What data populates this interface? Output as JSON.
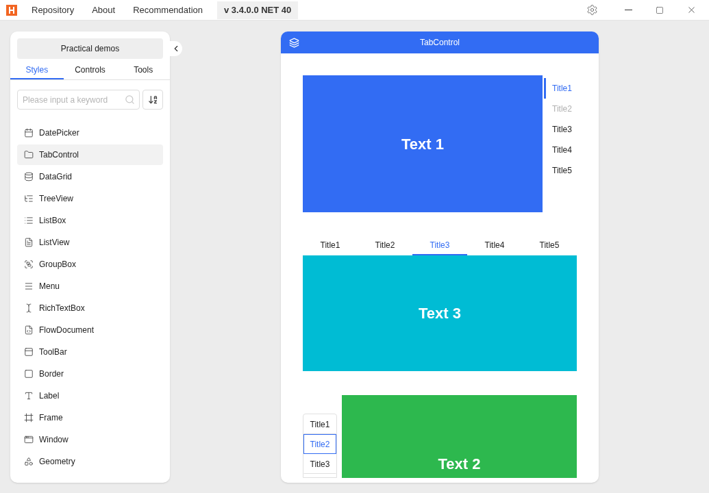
{
  "topbar": {
    "menu": [
      "Repository",
      "About",
      "Recommendation"
    ],
    "version": "v 3.4.0.0 NET 40"
  },
  "sidebar": {
    "demo_button": "Practical demos",
    "tabs": [
      {
        "label": "Styles",
        "selected": true
      },
      {
        "label": "Controls",
        "selected": false
      },
      {
        "label": "Tools",
        "selected": false
      }
    ],
    "search": {
      "placeholder": "Please input a keyword"
    },
    "items": [
      {
        "label": "DatePicker",
        "selected": false
      },
      {
        "label": "TabControl",
        "selected": true
      },
      {
        "label": "DataGrid",
        "selected": false
      },
      {
        "label": "TreeView",
        "selected": false
      },
      {
        "label": "ListBox",
        "selected": false
      },
      {
        "label": "ListView",
        "selected": false
      },
      {
        "label": "GroupBox",
        "selected": false
      },
      {
        "label": "Menu",
        "selected": false
      },
      {
        "label": "RichTextBox",
        "selected": false
      },
      {
        "label": "FlowDocument",
        "selected": false
      },
      {
        "label": "ToolBar",
        "selected": false
      },
      {
        "label": "Border",
        "selected": false
      },
      {
        "label": "Label",
        "selected": false
      },
      {
        "label": "Frame",
        "selected": false
      },
      {
        "label": "Window",
        "selected": false
      },
      {
        "label": "Geometry",
        "selected": false
      }
    ]
  },
  "demo": {
    "title": "TabControl",
    "tab_controls": [
      {
        "kind": "right",
        "content": "Text 1",
        "color": "#326cf3",
        "tabs": [
          {
            "label": "Title1",
            "selected": true,
            "disabled": false
          },
          {
            "label": "Title2",
            "selected": false,
            "disabled": true
          },
          {
            "label": "Title3",
            "selected": false,
            "disabled": false
          },
          {
            "label": "Title4",
            "selected": false,
            "disabled": false
          },
          {
            "label": "Title5",
            "selected": false,
            "disabled": false
          }
        ]
      },
      {
        "kind": "top",
        "content": "Text 3",
        "color": "#00bcd4",
        "tabs": [
          {
            "label": "Title1",
            "selected": false,
            "disabled": false
          },
          {
            "label": "Title2",
            "selected": false,
            "disabled": false
          },
          {
            "label": "Title3",
            "selected": true,
            "disabled": false
          },
          {
            "label": "Title4",
            "selected": false,
            "disabled": false
          },
          {
            "label": "Title5",
            "selected": false,
            "disabled": false
          }
        ]
      },
      {
        "kind": "left",
        "content": "Text 2",
        "color": "#2db84e",
        "tabs": [
          {
            "label": "Title1",
            "selected": false,
            "disabled": false
          },
          {
            "label": "Title2",
            "selected": true,
            "disabled": false
          },
          {
            "label": "Title3",
            "selected": false,
            "disabled": false
          }
        ]
      }
    ]
  }
}
